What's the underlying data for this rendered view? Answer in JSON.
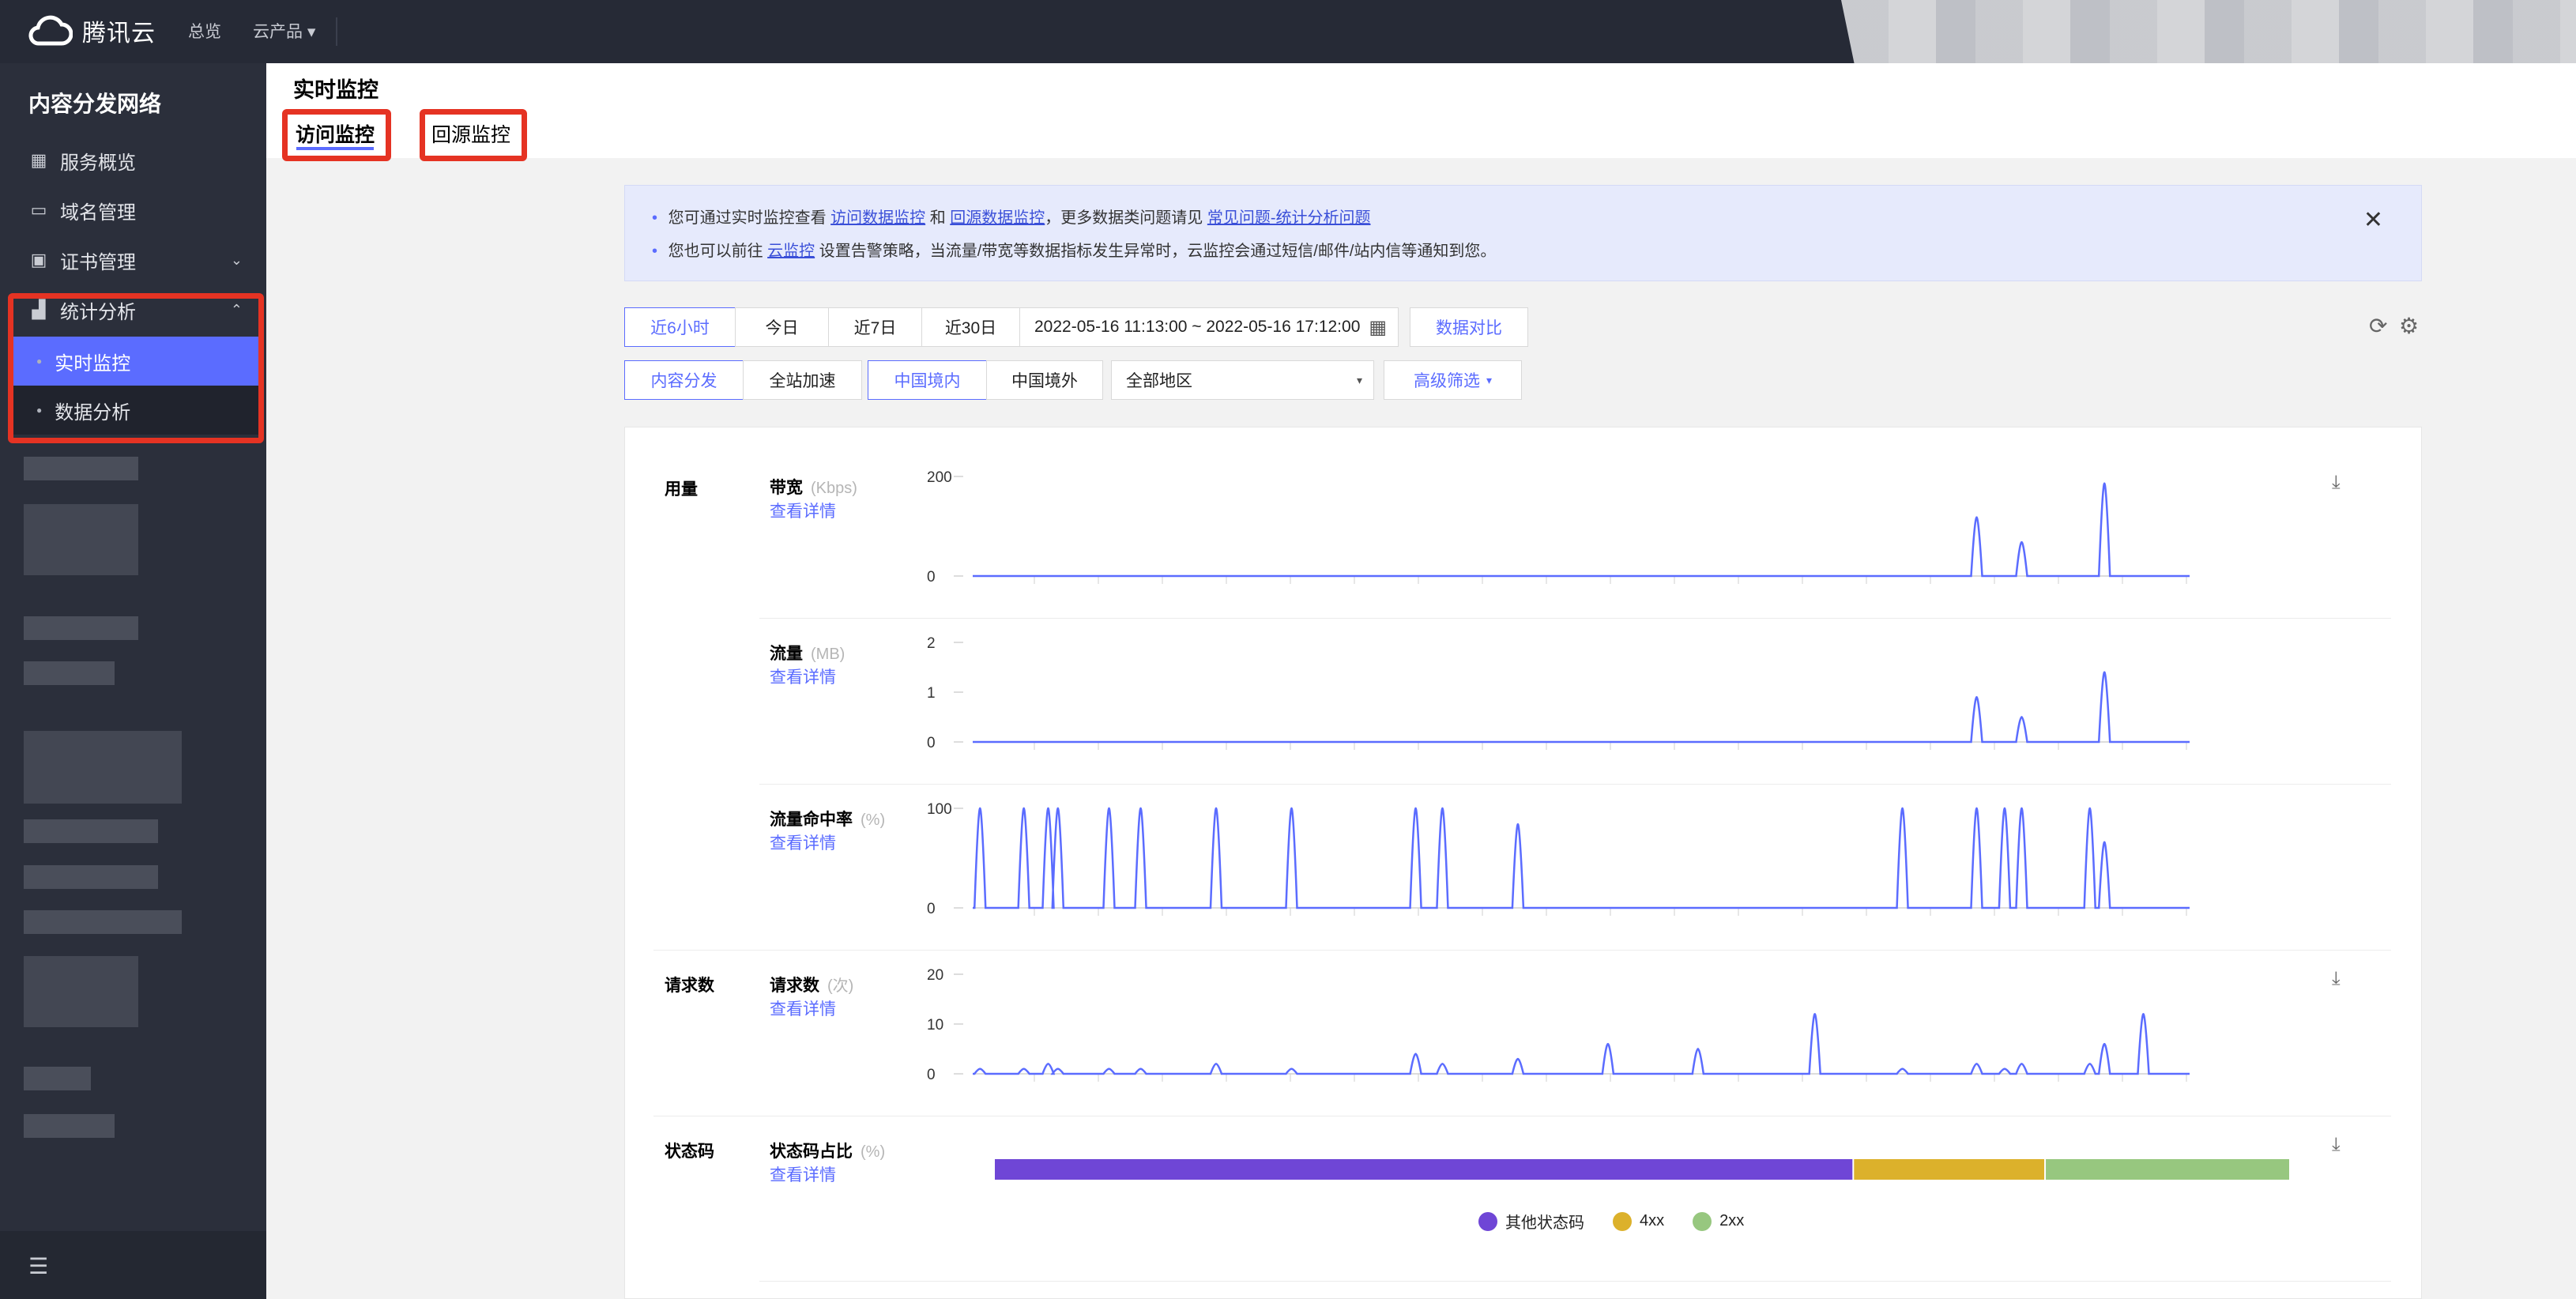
{
  "topbar": {
    "brand": "腾讯云",
    "nav_overview": "总览",
    "nav_products": "云产品",
    "nav_products_caret": "▾"
  },
  "sidebar": {
    "title": "内容分发网络",
    "items": [
      {
        "label": "服务概览",
        "icon": "grid-icon"
      },
      {
        "label": "域名管理",
        "icon": "domain-icon"
      },
      {
        "label": "证书管理",
        "icon": "certificate-icon",
        "chevron": "⌄"
      },
      {
        "label": "统计分析",
        "icon": "bar-chart-icon",
        "chevron": "⌃"
      }
    ],
    "sub_items": [
      {
        "label": "实时监控",
        "active": true
      },
      {
        "label": "数据分析",
        "active": false
      }
    ],
    "collapse_icon": "☰"
  },
  "main": {
    "title": "实时监控",
    "tabs": [
      {
        "label": "访问监控",
        "active": true
      },
      {
        "label": "回源监控",
        "active": false
      }
    ]
  },
  "notice": {
    "l1_a": "您可通过实时监控查看",
    "l1_link1": "访问数据监控",
    "l1_b": "和",
    "l1_link2": "回源数据监控",
    "l1_c": "，更多数据类问题请见",
    "l1_link3": "常见问题-统计分析问题",
    "l2_a": "您也可以前往",
    "l2_link": "云监控",
    "l2_b": "设置告警策略，当流量/带宽等数据指标发生异常时，云监控会通过短信/邮件/站内信等通知到您。",
    "close": "✕"
  },
  "filters": {
    "time_buttons": [
      "近6小时",
      "今日",
      "近7日",
      "近30日"
    ],
    "time_selected": "近6小时",
    "date_range": "2022-05-16 11:13:00 ~ 2022-05-16 17:12:00",
    "compare": "数据对比",
    "service_buttons": [
      "内容分发",
      "全站加速"
    ],
    "region_buttons": [
      "中国境内",
      "中国境外"
    ],
    "area_select": "全部地区",
    "advanced": "高级筛选",
    "caret": "▾"
  },
  "panel": {
    "sections": {
      "usage": "用量",
      "requests": "请求数",
      "status": "状态码"
    },
    "detail_link": "查看详情",
    "download_icon": "⤓",
    "rows": [
      {
        "title": "带宽",
        "unit": "(Kbps)"
      },
      {
        "title": "流量",
        "unit": "(MB)"
      },
      {
        "title": "流量命中率",
        "unit": "(%)"
      },
      {
        "title": "请求数",
        "unit": "(次)"
      },
      {
        "title": "状态码占比",
        "unit": "(%)"
      }
    ]
  },
  "chart_data": [
    {
      "type": "line",
      "title": "带宽",
      "unit": "Kbps",
      "ylim": [
        0,
        200
      ],
      "yticks": [
        "200",
        "0"
      ],
      "peaks": [
        {
          "x": 0.825,
          "y": 118
        },
        {
          "x": 0.862,
          "y": 68
        },
        {
          "x": 0.93,
          "y": 186
        }
      ],
      "color": "#5b6cff"
    },
    {
      "type": "line",
      "title": "流量",
      "unit": "MB",
      "ylim": [
        0,
        2
      ],
      "yticks": [
        "2",
        "1",
        "0"
      ],
      "peaks": [
        {
          "x": 0.825,
          "y": 0.9
        },
        {
          "x": 0.862,
          "y": 0.5
        },
        {
          "x": 0.93,
          "y": 1.4
        }
      ],
      "color": "#5b6cff"
    },
    {
      "type": "line",
      "title": "流量命中率",
      "unit": "%",
      "ylim": [
        0,
        100
      ],
      "yticks": [
        "100",
        "0"
      ],
      "peaks": [
        {
          "x": 0.006,
          "y": 100
        },
        {
          "x": 0.042,
          "y": 100
        },
        {
          "x": 0.062,
          "y": 100
        },
        {
          "x": 0.07,
          "y": 100
        },
        {
          "x": 0.112,
          "y": 100
        },
        {
          "x": 0.138,
          "y": 100
        },
        {
          "x": 0.2,
          "y": 100
        },
        {
          "x": 0.262,
          "y": 100
        },
        {
          "x": 0.364,
          "y": 100
        },
        {
          "x": 0.386,
          "y": 100
        },
        {
          "x": 0.448,
          "y": 84
        },
        {
          "x": 0.764,
          "y": 100
        },
        {
          "x": 0.825,
          "y": 100
        },
        {
          "x": 0.848,
          "y": 100
        },
        {
          "x": 0.862,
          "y": 100
        },
        {
          "x": 0.918,
          "y": 100
        },
        {
          "x": 0.93,
          "y": 66
        }
      ],
      "color": "#5b6cff"
    },
    {
      "type": "line",
      "title": "请求数",
      "unit": "次",
      "ylim": [
        0,
        20
      ],
      "yticks": [
        "20",
        "10",
        "0"
      ],
      "peaks": [
        {
          "x": 0.006,
          "y": 1
        },
        {
          "x": 0.042,
          "y": 1
        },
        {
          "x": 0.062,
          "y": 2
        },
        {
          "x": 0.07,
          "y": 1
        },
        {
          "x": 0.112,
          "y": 1
        },
        {
          "x": 0.138,
          "y": 1
        },
        {
          "x": 0.2,
          "y": 2
        },
        {
          "x": 0.262,
          "y": 1
        },
        {
          "x": 0.364,
          "y": 4
        },
        {
          "x": 0.386,
          "y": 2
        },
        {
          "x": 0.448,
          "y": 3
        },
        {
          "x": 0.522,
          "y": 6
        },
        {
          "x": 0.596,
          "y": 5
        },
        {
          "x": 0.692,
          "y": 12
        },
        {
          "x": 0.764,
          "y": 1
        },
        {
          "x": 0.825,
          "y": 2
        },
        {
          "x": 0.848,
          "y": 1
        },
        {
          "x": 0.862,
          "y": 2
        },
        {
          "x": 0.918,
          "y": 2
        },
        {
          "x": 0.93,
          "y": 6
        },
        {
          "x": 0.962,
          "y": 12
        }
      ],
      "color": "#5b6cff"
    },
    {
      "type": "bar",
      "title": "状态码占比",
      "unit": "%",
      "orientation": "stacked-horizontal",
      "series": [
        {
          "name": "其他状态码",
          "value": 66.3,
          "color": "#6f46d6"
        },
        {
          "name": "4xx",
          "value": 14.8,
          "color": "#dcb12b"
        },
        {
          "name": "2xx",
          "value": 18.9,
          "color": "#97c77f"
        }
      ]
    }
  ]
}
